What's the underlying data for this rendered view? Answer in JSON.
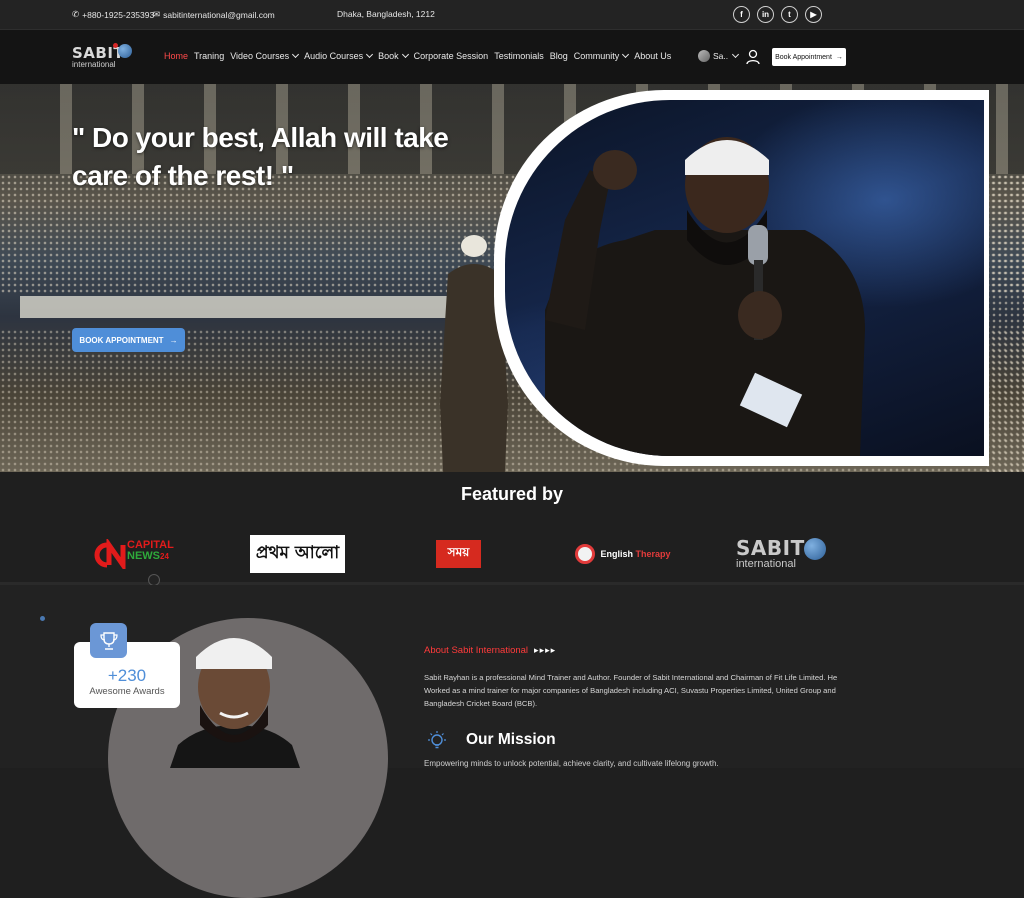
{
  "topbar": {
    "phone": "+880-1925-235393",
    "email": "sabitinternational@gmail.com",
    "address": "Dhaka, Bangladesh, 1212",
    "socials": [
      {
        "name": "facebook",
        "glyph": "f"
      },
      {
        "name": "linkedin",
        "glyph": "in"
      },
      {
        "name": "twitter",
        "glyph": "t"
      },
      {
        "name": "youtube",
        "glyph": "▶"
      }
    ]
  },
  "brand": {
    "name_top": "SABIT",
    "name_bottom": "international"
  },
  "nav": {
    "items": [
      {
        "label": "Home",
        "active": true,
        "dropdown": false
      },
      {
        "label": "Traning",
        "active": false,
        "dropdown": false
      },
      {
        "label": "Video Courses",
        "active": false,
        "dropdown": true
      },
      {
        "label": "Audio Courses",
        "active": false,
        "dropdown": true
      },
      {
        "label": "Book",
        "active": false,
        "dropdown": true
      },
      {
        "label": "Corporate Session",
        "active": false,
        "dropdown": false
      },
      {
        "label": "Testimonials",
        "active": false,
        "dropdown": false
      },
      {
        "label": "Blog",
        "active": false,
        "dropdown": false
      },
      {
        "label": "Community",
        "active": false,
        "dropdown": true
      },
      {
        "label": "About Us",
        "active": false,
        "dropdown": false
      }
    ],
    "language_label": "Sa..",
    "book_button": "Book Appointment"
  },
  "hero": {
    "quote": "\" Do your best, Allah will take care of the rest! \"",
    "cta": "BOOK APPOINTMENT"
  },
  "featured": {
    "title": "Featured by",
    "logos": [
      "CAPITAL NEWS24",
      "প্রথম আলো",
      "সময়",
      "English Therapy",
      "SABIT international"
    ]
  },
  "awards": {
    "count": "+230",
    "label": "Awesome Awards"
  },
  "about": {
    "heading": "About Sabit International",
    "arrows": "▸▸▸▸",
    "text": "Sabit Rayhan is a professional Mind Trainer and Author. Founder of Sabit International and Chairman of Fit Life Limited. He Worked as a mind trainer for major companies of Bangladesh including ACI, Suvastu Properties Limited, United Group and Bangladesh Cricket Board (BCB)."
  },
  "mission": {
    "title": "Our Mission",
    "text": "Empowering minds to unlock potential, achieve clarity, and cultivate lifelong growth."
  },
  "colors": {
    "accent_red": "#ff3b3b",
    "accent_blue": "#4f8ed8",
    "bg_dark": "#1f1f1f"
  }
}
